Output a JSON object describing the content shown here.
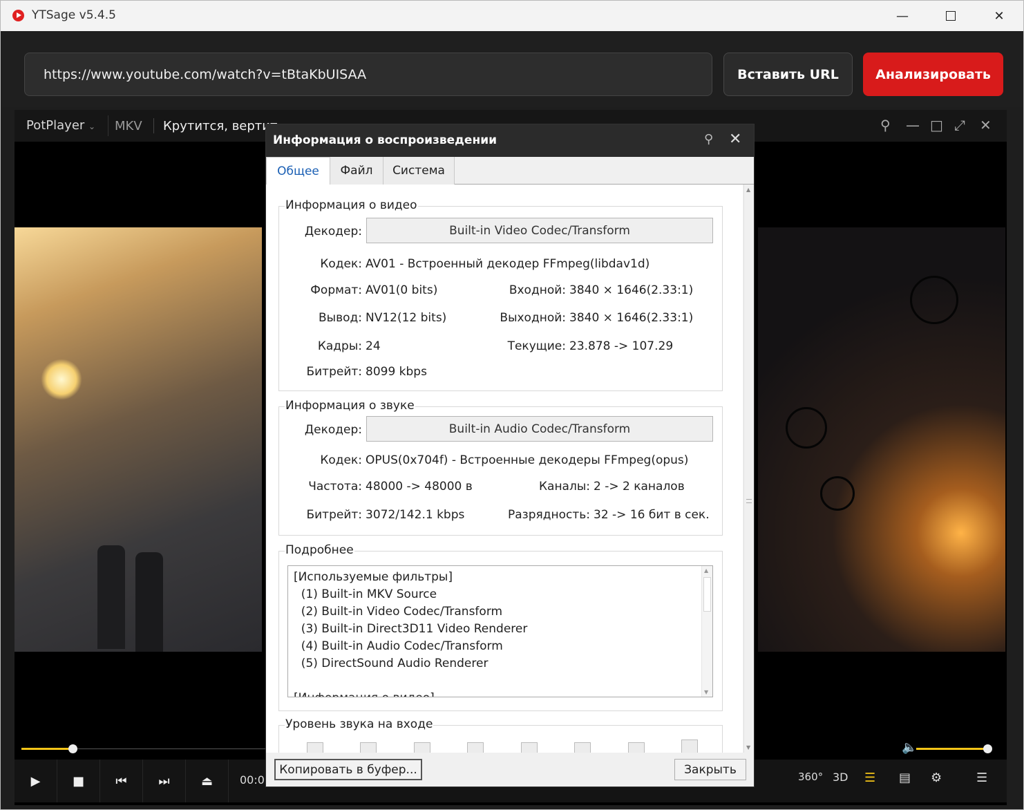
{
  "window": {
    "title": "YTSage  v5.4.5",
    "icons": {
      "app": "ytsage-app-icon",
      "minimize": "minimize-icon",
      "maximize": "maximize-icon",
      "close": "close-icon"
    }
  },
  "ytsage": {
    "url_value": "https://www.youtube.com/watch?v=tBtaKbUISAA",
    "paste_label": "Вставить URL",
    "analyze_label": "Анализировать",
    "accent": "#d81b1b"
  },
  "player": {
    "brand": "PotPlayer",
    "format": "MKV",
    "title": "Крутится, вертит",
    "time": "00:0",
    "seek_fraction": 0.16,
    "volume_fraction": 1.0,
    "accent": "#f5c518",
    "right_icons": [
      "360°",
      "3D"
    ]
  },
  "dialog": {
    "title": "Информация о воспроизведении",
    "tabs": [
      "Общее",
      "Файл",
      "Система"
    ],
    "video": {
      "group_label": "Информация о видео",
      "decoder_label": "Декодер:",
      "decoder_value": "Built-in Video Codec/Transform",
      "codec_label": "Кодек:",
      "codec_value": "AV01 - Встроенный декодер FFmpeg(libdav1d)",
      "format_label": "Формат:",
      "format_value": "AV01(0 bits)",
      "input_label": "Входной:",
      "input_value": "3840 × 1646(2.33:1)",
      "output_label": "Вывод:",
      "output_value": "NV12(12 bits)",
      "out_res_label": "Выходной:",
      "out_res_value": "3840 × 1646(2.33:1)",
      "frames_label": "Кадры:",
      "frames_value": "24",
      "current_label": "Текущие:",
      "current_value": "23.878 -> 107.29",
      "bitrate_label": "Битрейт:",
      "bitrate_value": "8099 kbps"
    },
    "audio": {
      "group_label": "Информация о звуке",
      "decoder_label": "Декодер:",
      "decoder_value": "Built-in Audio Codec/Transform",
      "codec_label": "Кодек:",
      "codec_value": "OPUS(0x704f) - Встроенные декодеры FFmpeg(opus)",
      "freq_label": "Частота:",
      "freq_value": "48000 -> 48000 в",
      "channels_label": "Каналы:",
      "channels_value": "2 -> 2 каналов",
      "bitrate_label": "Битрейт:",
      "bitrate_value": "3072/142.1 kbps",
      "depth_label": "Разрядность:",
      "depth_value": "32 -> 16 бит в сек."
    },
    "details": {
      "group_label": "Подробнее",
      "lines": [
        "[Используемые фильтры]",
        "  (1) Built-in MKV Source",
        "  (2) Built-in Video Codec/Transform",
        "  (3) Built-in Direct3D11 Video Renderer",
        "  (4) Built-in Audio Codec/Transform",
        "  (5) DirectSound Audio Renderer",
        "",
        "[Информация о видео]"
      ]
    },
    "level": {
      "group_label": "Уровень звука на входе"
    },
    "copy_label": "Копировать в буфер...",
    "close_label": "Закрыть"
  }
}
